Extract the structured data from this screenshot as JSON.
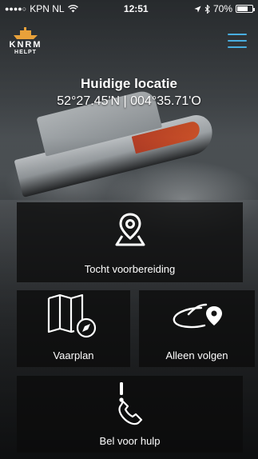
{
  "status_bar": {
    "carrier": "KPN NL",
    "time": "12:51",
    "battery_percent": "70%",
    "battery_level": 0.7,
    "icons": [
      "signal-dots-icon",
      "wifi-icon",
      "location-arrow-icon",
      "bluetooth-icon",
      "battery-icon"
    ]
  },
  "header": {
    "logo_brand": "KNRM",
    "logo_sub": "HELPT",
    "menu_icon": "hamburger-menu-icon",
    "accent_color": "#49aee0"
  },
  "location": {
    "title": "Huidige locatie",
    "coordinates": "52°27.45'N | 004°35.71'O"
  },
  "tiles": [
    {
      "label": "Tocht voorbereiding",
      "icon": "map-pin-icon"
    },
    {
      "label": "Vaarplan",
      "icon": "folded-map-compass-icon"
    },
    {
      "label": "Alleen volgen",
      "icon": "orbit-pin-icon"
    },
    {
      "label": "Bel voor hulp",
      "icon": "phone-alert-icon"
    }
  ]
}
